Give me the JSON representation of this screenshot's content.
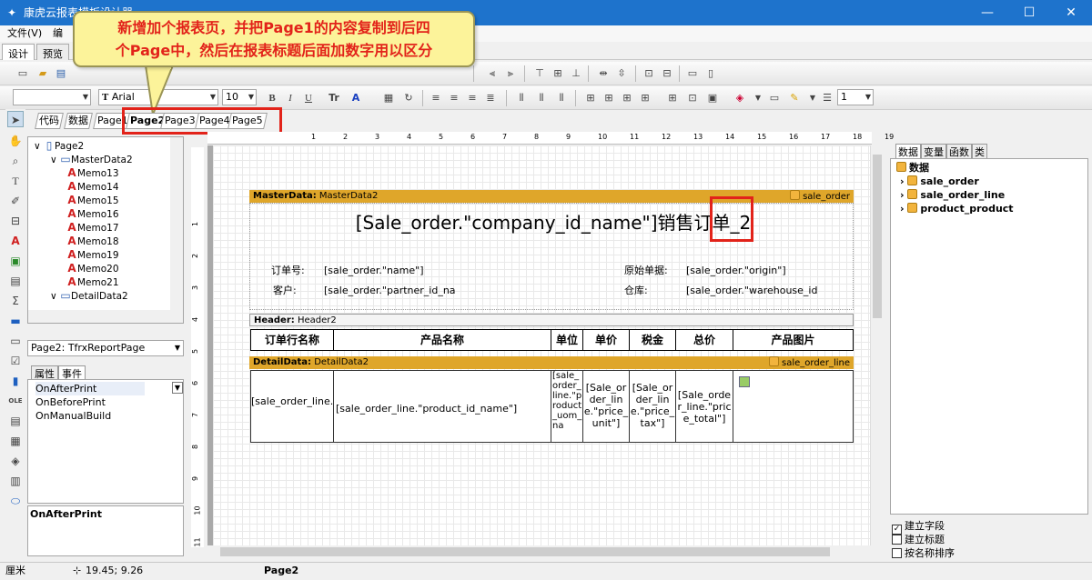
{
  "window": {
    "title": "康虎云报表模板设计器",
    "min": "—",
    "max": "☐",
    "close": "✕"
  },
  "menu": [
    "文件(V)",
    "编"
  ],
  "modes": [
    "设计",
    "预览"
  ],
  "callout": {
    "line1": "新增加个报表页，并把Page1的内容复制到后四",
    "line2": "个Page中，然后在报表标题后面加数字用以区分"
  },
  "toolbar": {
    "font_name": "Arial",
    "font_size": "10",
    "line_width": "1",
    "bold": "B",
    "italic": "I",
    "underline": "U"
  },
  "page_tabs": [
    "代码",
    "数据",
    "Page1",
    "Page2",
    "Page3",
    "Page4",
    "Page5"
  ],
  "tree": [
    {
      "label": "Page2",
      "indent": 0
    },
    {
      "label": "MasterData2",
      "indent": 1
    },
    {
      "label": "Memo13",
      "indent": 2
    },
    {
      "label": "Memo14",
      "indent": 2
    },
    {
      "label": "Memo15",
      "indent": 2
    },
    {
      "label": "Memo16",
      "indent": 2
    },
    {
      "label": "Memo17",
      "indent": 2
    },
    {
      "label": "Memo18",
      "indent": 2
    },
    {
      "label": "Memo19",
      "indent": 2
    },
    {
      "label": "Memo20",
      "indent": 2
    },
    {
      "label": "Memo21",
      "indent": 2
    },
    {
      "label": "DetailData2",
      "indent": 1
    }
  ],
  "object_combo": "Page2: TfrxReportPage",
  "prop_tabs": [
    "属性",
    "事件"
  ],
  "events": [
    "OnAfterPrint",
    "OnBeforePrint",
    "OnManualBuild"
  ],
  "prop_desc": "OnAfterPrint",
  "ruler": [
    "1",
    "2",
    "3",
    "4",
    "5",
    "6",
    "7",
    "8",
    "9",
    "10",
    "11",
    "12",
    "13",
    "14",
    "15",
    "16",
    "17",
    "18",
    "19"
  ],
  "vruler": [
    "1",
    "2",
    "3",
    "4",
    "5",
    "6",
    "7",
    "8",
    "9",
    "10",
    "11"
  ],
  "report": {
    "master_band": {
      "label": "MasterData:",
      "name": "MasterData2",
      "source": "sale_order"
    },
    "title": "[Sale_order.\"company_id_name\"]销售订单_2",
    "order_no_label": "订单号:",
    "order_no_value": "[sale_order.\"name\"]",
    "origin_label": "原始单据:",
    "origin_value": "[sale_order.\"origin\"]",
    "customer_label": "客户:",
    "customer_value": "[sale_order.\"partner_id_na",
    "warehouse_label": "仓库:",
    "warehouse_value": "[sale_order.\"warehouse_id",
    "header_band": {
      "label": "Header:",
      "name": "Header2"
    },
    "columns": [
      "订单行名称",
      "产品名称",
      "单位",
      "单价",
      "税金",
      "总价",
      "产品图片"
    ],
    "detail_band": {
      "label": "DetailData:",
      "name": "DetailData2",
      "source": "sale_order_line"
    },
    "detail_cells": [
      "[sale_order_line.\"name\"]",
      "[sale_order_line.\"product_id_name\"]",
      "[sale_order_line.\"product_uom_na",
      "[Sale_order_line.\"price_unit\"]",
      "[Sale_order_line.\"price_tax\"]",
      "[Sale_order_line.\"price_total\"]"
    ]
  },
  "right_tabs": [
    "数据",
    "变量",
    "函数",
    "类"
  ],
  "data_tree": {
    "root": "数据",
    "items": [
      "sale_order",
      "sale_order_line",
      "product_product"
    ]
  },
  "checks": [
    {
      "label": "建立字段",
      "checked": true
    },
    {
      "label": "建立标题",
      "checked": false
    },
    {
      "label": "按名称排序",
      "checked": false
    }
  ],
  "status": {
    "unit": "厘米",
    "pos": "19.45; 9.26",
    "page": "Page2"
  },
  "colors": {
    "band": "#dfa62a",
    "highlight": "#e2231a",
    "callout": "#fcf39a",
    "titlebar": "#1e73cc"
  }
}
